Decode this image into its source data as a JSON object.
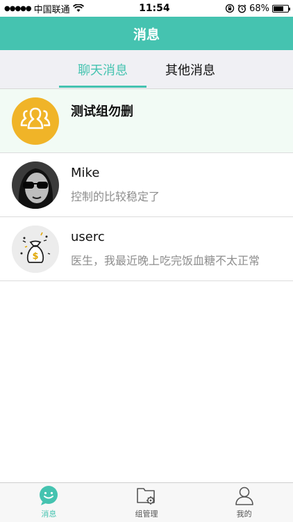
{
  "status": {
    "carrier": "中国联通",
    "time": "11:54",
    "battery": "68%",
    "battery_level": 0.68,
    "signal_icon": "signal-dots-icon",
    "wifi_icon": "wifi-icon"
  },
  "nav": {
    "title": "消息"
  },
  "tabs": [
    {
      "label": "聊天消息",
      "active": true
    },
    {
      "label": "其他消息",
      "active": false
    }
  ],
  "conversations": [
    {
      "name": "测试组勿删",
      "message": "",
      "avatar_icon": "group-icon",
      "highlight": true
    },
    {
      "name": "Mike",
      "message": "控制的比较稳定了",
      "avatar_icon": "person-sunglasses-avatar"
    },
    {
      "name": "userc",
      "message": "医生，我最近晚上吃完饭血糖不太正常",
      "avatar_icon": "money-bag-avatar"
    }
  ],
  "tabbar": [
    {
      "label": "消息",
      "icon": "chat-bubble-icon",
      "active": true
    },
    {
      "label": "组管理",
      "icon": "folder-gear-icon",
      "active": false
    },
    {
      "label": "我的",
      "icon": "user-icon",
      "active": false
    }
  ],
  "colors": {
    "accent": "#45c3b0",
    "group_avatar": "#f0b428"
  }
}
